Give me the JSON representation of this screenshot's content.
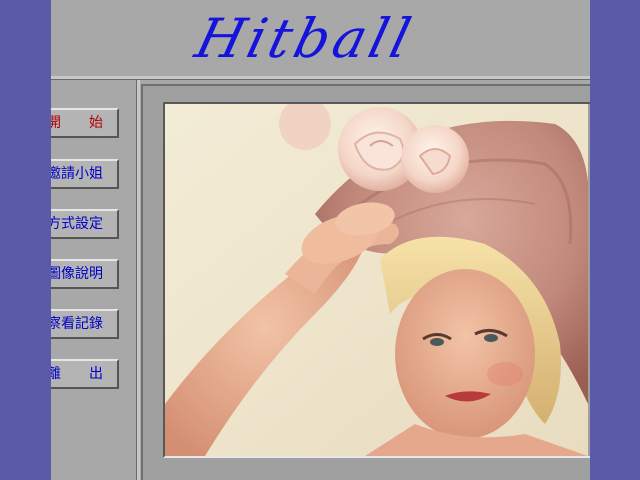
{
  "app": {
    "logo_text": "Hitball"
  },
  "menu": {
    "items": [
      {
        "label": "開　　始",
        "key": "start",
        "color": "red"
      },
      {
        "label": "邀請小姐",
        "key": "invite",
        "color": "blue"
      },
      {
        "label": "方式設定",
        "key": "settings",
        "color": "blue"
      },
      {
        "label": "圖像說明",
        "key": "image-info",
        "color": "blue"
      },
      {
        "label": "察看記錄",
        "key": "records",
        "color": "blue"
      },
      {
        "label": "離　　出",
        "key": "exit",
        "color": "blue"
      }
    ]
  },
  "colors": {
    "background": "#5a5aa8",
    "panel": "#a8a8a8",
    "logo": "#1414dc",
    "menu_text": "#0000c8",
    "menu_text_active": "#b00000"
  },
  "photo": {
    "subject": "portrait-woman-pink-hat-rose-icon"
  }
}
